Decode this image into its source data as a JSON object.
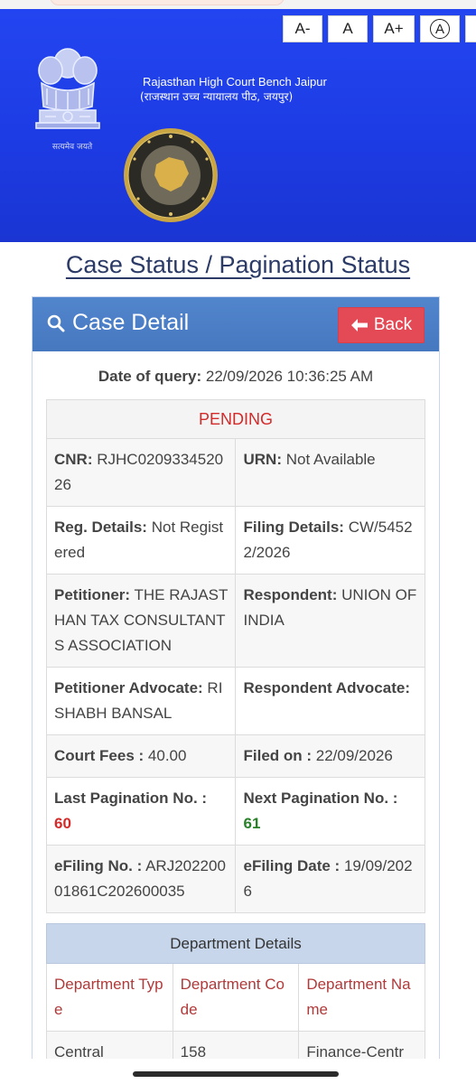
{
  "header": {
    "font_controls": [
      "A-",
      "A",
      "A+",
      "A"
    ],
    "emblem_caption": "सत्यमेव जयते",
    "court_name": "Rajasthan High Court Bench Jaipur",
    "court_name_hindi": "(राजस्थान उच्च न्यायालय पीठ, जयपुर)"
  },
  "page_title": "Case Status / Pagination Status",
  "panel": {
    "title": "Case Detail",
    "back_label": "Back",
    "query_label": "Date of query:",
    "query_value": "22/09/2026 10:36:25 AM"
  },
  "case": {
    "status": "PENDING",
    "rows": [
      [
        {
          "label": "CNR:",
          "value": "RJHC020933452026"
        },
        {
          "label": "URN:",
          "value": "Not Available"
        }
      ],
      [
        {
          "label": "Reg. Details:",
          "value": "Not Registered"
        },
        {
          "label": "Filing Details:",
          "value": "CW/54522/2026"
        }
      ],
      [
        {
          "label": "Petitioner:",
          "value": "THE RAJASTHAN TAX CONSULTANTS ASSOCIATION"
        },
        {
          "label": "Respondent:",
          "value": "UNION OF INDIA"
        }
      ],
      [
        {
          "label": "Petitioner Advocate:",
          "value": "RISHABH BANSAL"
        },
        {
          "label": "Respondent Advocate:",
          "value": ""
        }
      ],
      [
        {
          "label": "Court Fees :",
          "value": "40.00"
        },
        {
          "label": "Filed on :",
          "value": "22/09/2026"
        }
      ],
      [
        {
          "label": "Last Pagination No. :",
          "value": "60"
        },
        {
          "label": "Next Pagination No. :",
          "value": "61"
        }
      ],
      [
        {
          "label": "eFiling No. :",
          "value": "ARJ20220001861C202600035"
        },
        {
          "label": "eFiling Date :",
          "value": "19/09/2026"
        }
      ]
    ]
  },
  "department": {
    "title": "Department Details",
    "columns": [
      "Department Type",
      "Department Code",
      "Department Name"
    ],
    "rows": [
      [
        "Central",
        "158",
        "Finance-Centr"
      ]
    ]
  },
  "colors": {
    "header_blue": "#1f3fe0",
    "panel_head": "#4a7ec6",
    "back_button": "#e44a55",
    "pending_red": "#d32a2a",
    "next_green": "#2a7f2a"
  }
}
